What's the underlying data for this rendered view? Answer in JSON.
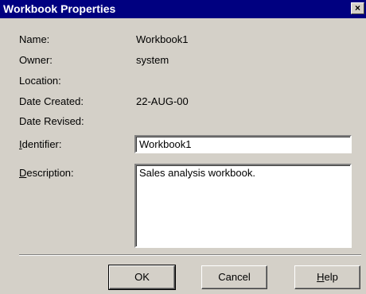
{
  "window": {
    "title": "Workbook Properties",
    "close_label": "×"
  },
  "properties": [
    {
      "label": "Name:",
      "value": "Workbook1"
    },
    {
      "label": "Owner:",
      "value": "system"
    },
    {
      "label": "Location:",
      "value": ""
    },
    {
      "label": "Date Created:",
      "value": "22-AUG-00"
    },
    {
      "label": "Date Revised:",
      "value": ""
    }
  ],
  "identifier": {
    "label_accel": "I",
    "label_rest": "dentifier:",
    "value": "Workbook1"
  },
  "description": {
    "label_accel": "D",
    "label_rest": "escription:",
    "value": "Sales analysis workbook."
  },
  "buttons": {
    "ok": "OK",
    "cancel": "Cancel",
    "help_accel": "H",
    "help_rest": "elp"
  }
}
